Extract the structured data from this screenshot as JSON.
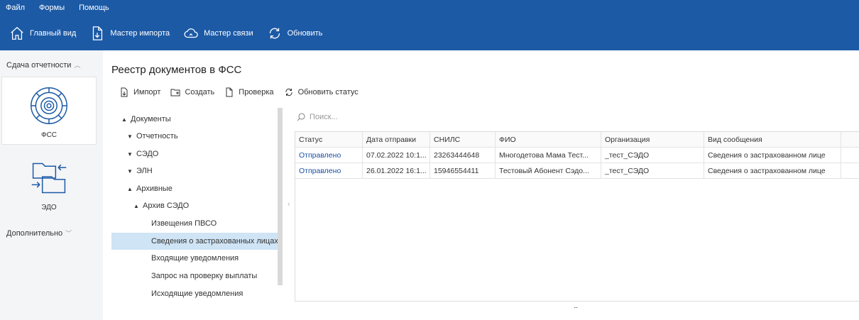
{
  "menu": [
    "Файл",
    "Формы",
    "Помощь"
  ],
  "toolbar": [
    {
      "label": "Главный вид",
      "icon": "home-icon"
    },
    {
      "label": "Мастер импорта",
      "icon": "import-icon"
    },
    {
      "label": "Мастер связи",
      "icon": "cloud-icon"
    },
    {
      "label": "Обновить",
      "icon": "refresh-icon"
    }
  ],
  "sidebar": {
    "section1": "Сдача отчетности",
    "tiles": [
      {
        "label": "ФСС",
        "icon": "fss-icon",
        "active": true
      },
      {
        "label": "ЭДО",
        "icon": "edo-icon",
        "active": false
      }
    ],
    "section2": "Дополнительно"
  },
  "main": {
    "title": "Реестр документов в ФСС",
    "actions": [
      {
        "label": "Импорт",
        "icon": "import-icon"
      },
      {
        "label": "Создать",
        "icon": "create-icon"
      },
      {
        "label": "Проверка",
        "icon": "check-icon"
      },
      {
        "label": "Обновить статус",
        "icon": "refresh-icon"
      }
    ],
    "tree": [
      {
        "label": "Документы",
        "level": 0,
        "expanded": true
      },
      {
        "label": "Отчетность",
        "level": 1,
        "expanded": false
      },
      {
        "label": "СЭДО",
        "level": 1,
        "expanded": false
      },
      {
        "label": "ЭЛН",
        "level": 1,
        "expanded": false
      },
      {
        "label": "Архивные",
        "level": 1,
        "expanded": true
      },
      {
        "label": "Архив СЭДО",
        "level": 2,
        "expanded": true
      },
      {
        "label": "Извещения ПВСО",
        "level": 3
      },
      {
        "label": "Сведения о застрахованных лицах",
        "level": 3,
        "selected": true
      },
      {
        "label": "Входящие уведомления",
        "level": 3
      },
      {
        "label": "Запрос на проверку выплаты",
        "level": 3
      },
      {
        "label": "Исходящие уведомления",
        "level": 3
      }
    ],
    "search_placeholder": "Поиск...",
    "columns": [
      "Статус",
      "Дата отправки",
      "СНИЛС",
      "ФИО",
      "Организация",
      "Вид сообщения"
    ],
    "rows": [
      [
        "Отправлено",
        "07.02.2022 10:1...",
        "23263444648",
        "Многодетова Мама Тест...",
        "_тест_СЭДО",
        "Сведения о застрахованном лице"
      ],
      [
        "Отправлено",
        "26.01.2022 16:1...",
        "15946554411",
        "Тестовый Абонент Сэдо...",
        "_тест_СЭДО",
        "Сведения о застрахованном лице"
      ]
    ],
    "footer_ellipsis": "..."
  }
}
